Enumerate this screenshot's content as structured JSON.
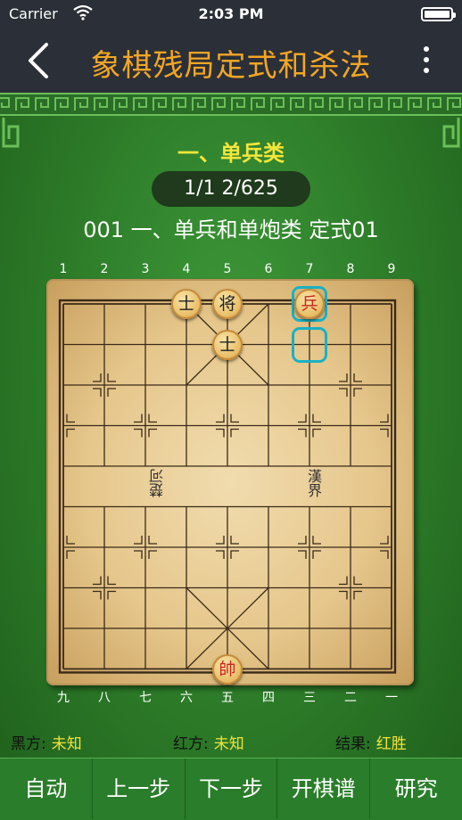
{
  "status_bar": {
    "carrier": "Carrier",
    "time": "2:03 PM",
    "battery_level": 1.0
  },
  "nav": {
    "title": "象棋残局定式和杀法",
    "back_icon": "chevron-left-icon",
    "more_icon": "more-vertical-icon"
  },
  "header": {
    "category": "一、单兵类",
    "counter": "1/1  2/625",
    "subtitle": "001  一、单兵和单炮类  定式01"
  },
  "board": {
    "top_numbers": [
      "1",
      "2",
      "3",
      "4",
      "5",
      "6",
      "7",
      "8",
      "9"
    ],
    "bottom_numbers": [
      "九",
      "八",
      "七",
      "六",
      "五",
      "四",
      "三",
      "二",
      "一"
    ],
    "river_left": "楚河",
    "river_right": "漢界",
    "pieces": [
      {
        "label": "士",
        "side": "black",
        "file": 4,
        "rank": 0
      },
      {
        "label": "将",
        "side": "black",
        "file": 5,
        "rank": 0
      },
      {
        "label": "兵",
        "side": "red",
        "file": 7,
        "rank": 0
      },
      {
        "label": "士",
        "side": "black",
        "file": 5,
        "rank": 1
      },
      {
        "label": "帥",
        "side": "red",
        "file": 5,
        "rank": 9
      }
    ],
    "highlights": [
      {
        "file": 7,
        "rank": 0
      },
      {
        "file": 7,
        "rank": 1
      }
    ],
    "colors": {
      "highlight": "#1ab1c4",
      "red_piece": "#c8261d",
      "black_piece": "#222222"
    }
  },
  "info": {
    "black_label": "黑方:",
    "black_value": "未知",
    "red_label": "红方:",
    "red_value": "未知",
    "result_label": "结果:",
    "result_value": "红胜"
  },
  "toolbar": {
    "buttons": [
      "自动",
      "上一步",
      "下一步",
      "开棋谱",
      "研究"
    ]
  }
}
